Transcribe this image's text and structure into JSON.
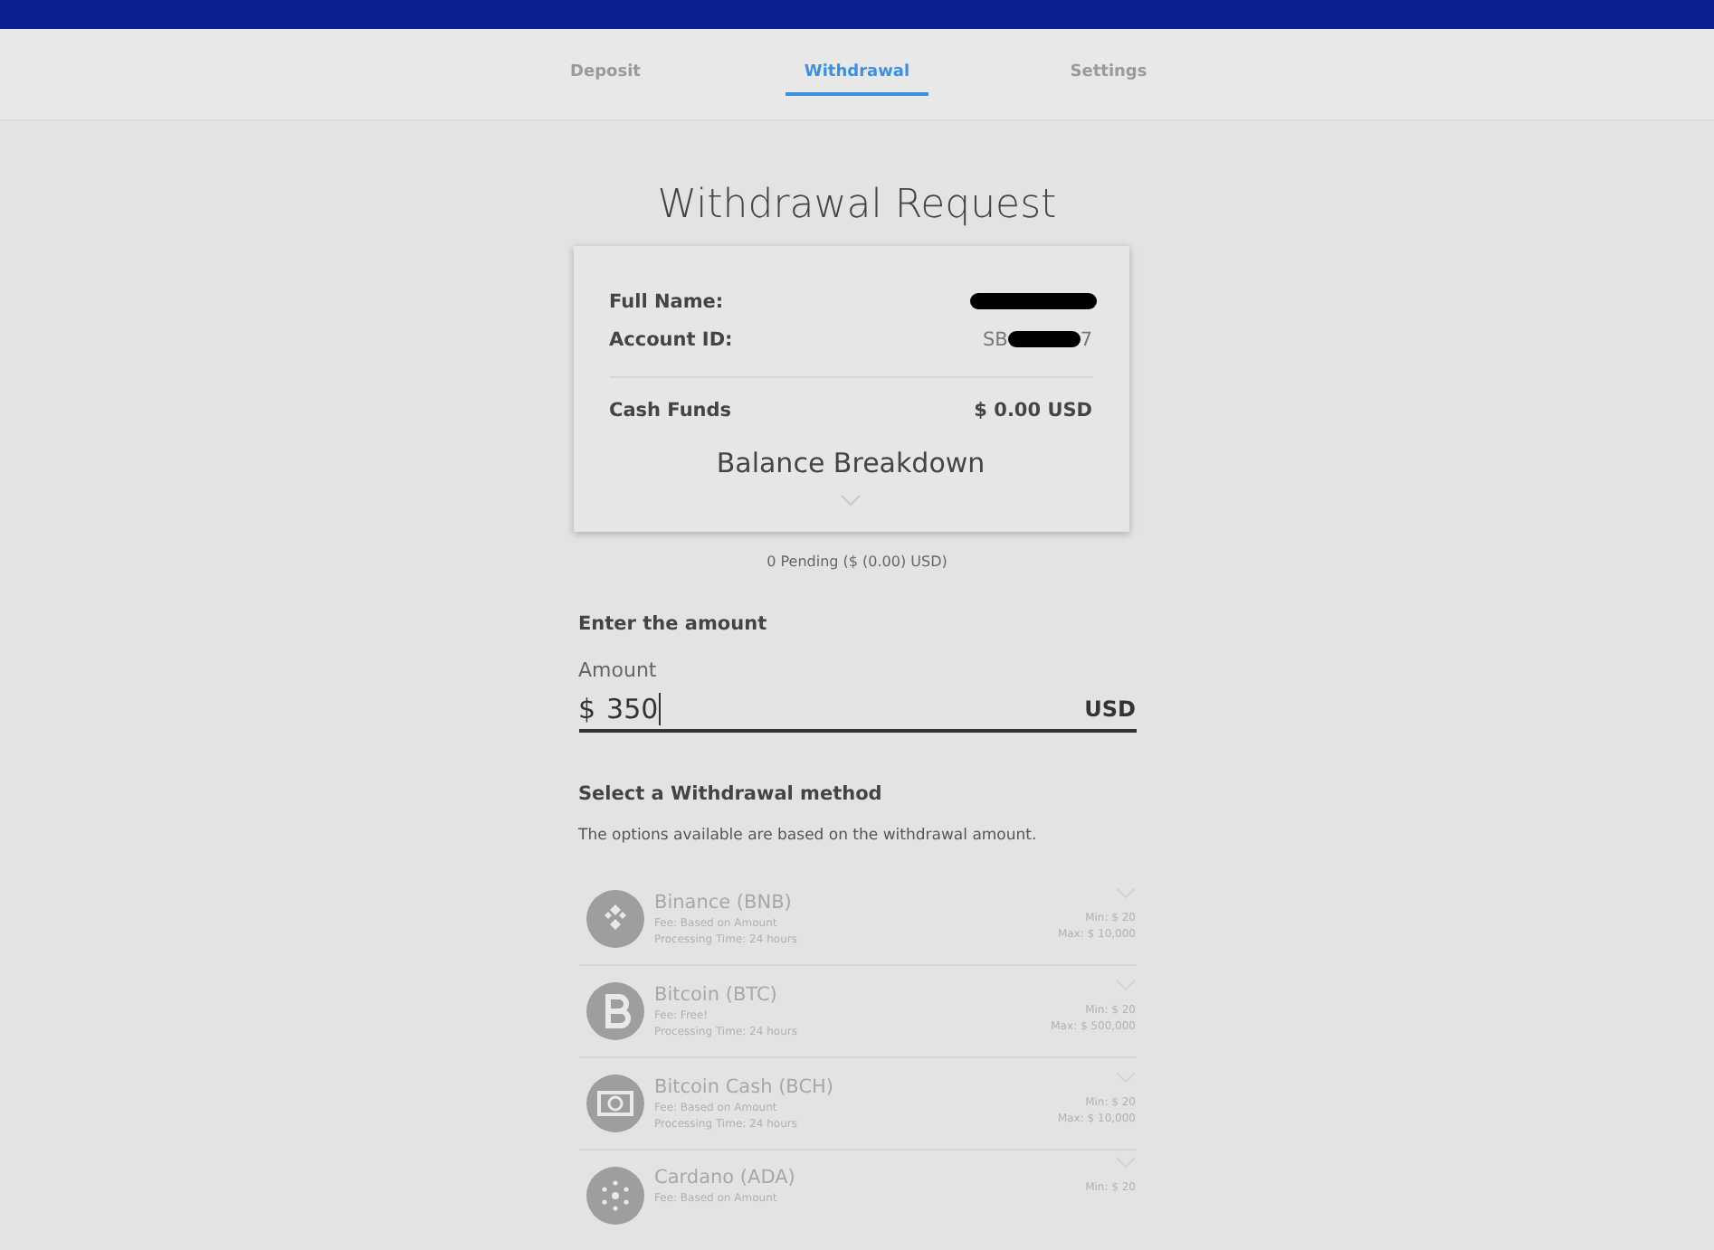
{
  "tabs": [
    {
      "label": "Deposit",
      "selected": false
    },
    {
      "label": "Withdrawal",
      "selected": true
    },
    {
      "label": "Settings",
      "selected": false
    }
  ],
  "title": "Withdrawal Request",
  "account_card": {
    "full_name_label": "Full Name:",
    "account_id_label": "Account ID:",
    "account_id_start": "SB",
    "account_id_end": "7",
    "cash_funds_label": "Cash Funds",
    "cash_funds_value": "$ 0.00 USD",
    "breakdown_title": "Balance Breakdown",
    "expanded": false
  },
  "pending": "0 Pending ($ (0.00) USD)",
  "amount_section": {
    "heading": "Enter the amount",
    "label": "Amount",
    "currency_symbol": "$",
    "value": "350",
    "currency": "USD"
  },
  "method_section": {
    "heading": "Select a Withdrawal method",
    "note": "The options available are based on the withdrawal amount."
  },
  "methods": [
    {
      "kind": "bnb",
      "name": "Binance (BNB)",
      "fee": "Fee: Based on Amount",
      "time": "Processing Time: 24 hours",
      "min": "Min: $ 20",
      "max": "Max: $ 10,000",
      "disabled": true
    },
    {
      "kind": "btc",
      "name": "Bitcoin (BTC)",
      "fee": "Fee: Free!",
      "time": "Processing Time: 24 hours",
      "min": "Min: $ 20",
      "max": "Max: $ 500,000",
      "disabled": true
    },
    {
      "kind": "bch",
      "name": "Bitcoin Cash (BCH)",
      "fee": "Fee: Based on Amount",
      "time": "Processing Time: 24 hours",
      "min": "Min: $ 20",
      "max": "Max: $ 10,000",
      "disabled": true
    },
    {
      "kind": "ada",
      "name": "Cardano (ADA)",
      "fee": "Fee: Based on Amount",
      "min": "Min: $ 20",
      "disabled": true
    }
  ]
}
